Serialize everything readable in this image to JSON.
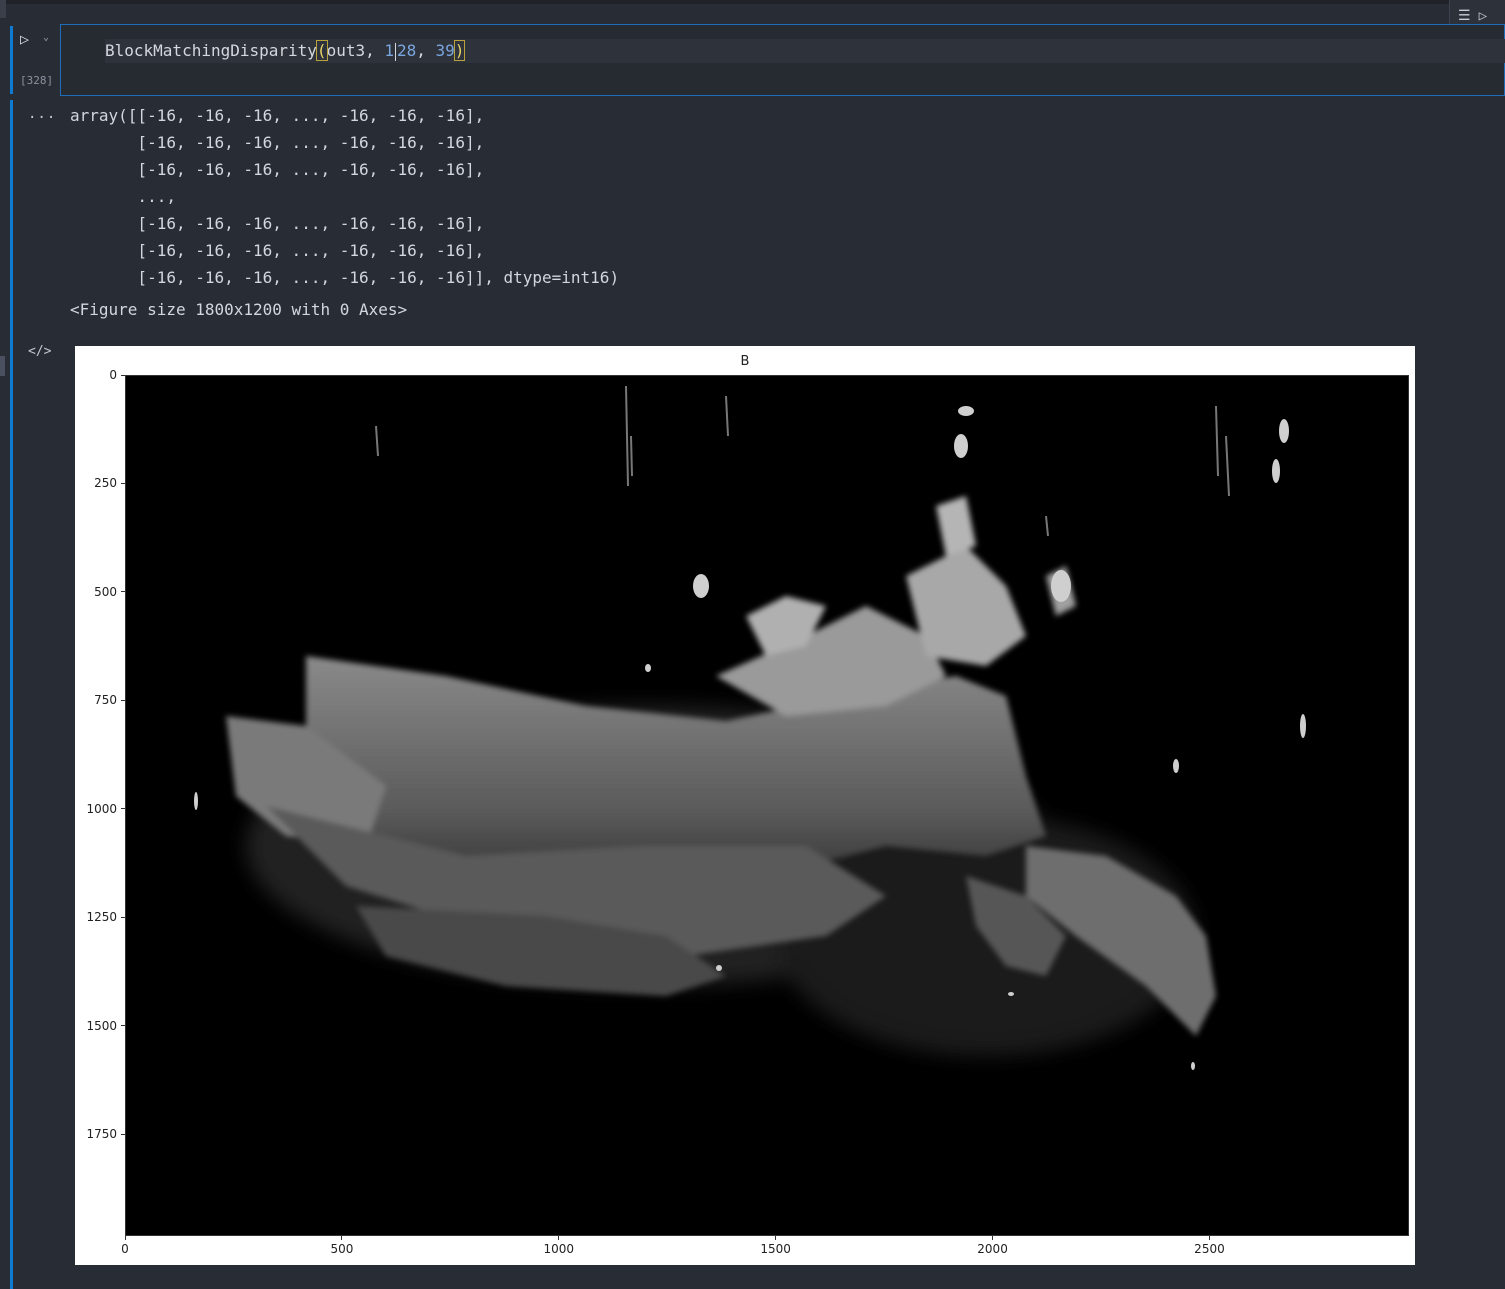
{
  "cell": {
    "execution_count": "[328]",
    "code": {
      "func": "BlockMatchingDisparity",
      "open_paren": "(",
      "arg1": "out3, ",
      "arg2_a": "1",
      "arg2_b": "28",
      "sep": ", ",
      "arg3": "39",
      "close_paren": ")"
    }
  },
  "output": {
    "ellipsis": "...",
    "array_text": "array([[-16, -16, -16, ..., -16, -16, -16],\n       [-16, -16, -16, ..., -16, -16, -16],\n       [-16, -16, -16, ..., -16, -16, -16],\n       ...,\n       [-16, -16, -16, ..., -16, -16, -16],\n       [-16, -16, -16, ..., -16, -16, -16],\n       [-16, -16, -16, ..., -16, -16, -16]], dtype=int16)",
    "figure_repr": "<Figure size 1800x1200 with 0 Axes>",
    "code_icon": "</>"
  },
  "toolbar": {
    "icons": [
      "run-by-line-icon",
      "run-all-icon"
    ]
  },
  "chart_data": {
    "type": "heatmap",
    "title": "B",
    "colormap": "gray",
    "xlim": [
      0,
      2960
    ],
    "ylim": [
      1985,
      0
    ],
    "xticks": [
      0,
      500,
      1000,
      1500,
      2000,
      2500
    ],
    "yticks": [
      0,
      250,
      500,
      750,
      1000,
      1250,
      1500,
      1750
    ],
    "xtick_labels": [
      "0",
      "500",
      "1000",
      "1500",
      "2000",
      "2500"
    ],
    "ytick_labels": [
      "0",
      "250",
      "500",
      "750",
      "1000",
      "1250",
      "1500",
      "1750"
    ]
  }
}
